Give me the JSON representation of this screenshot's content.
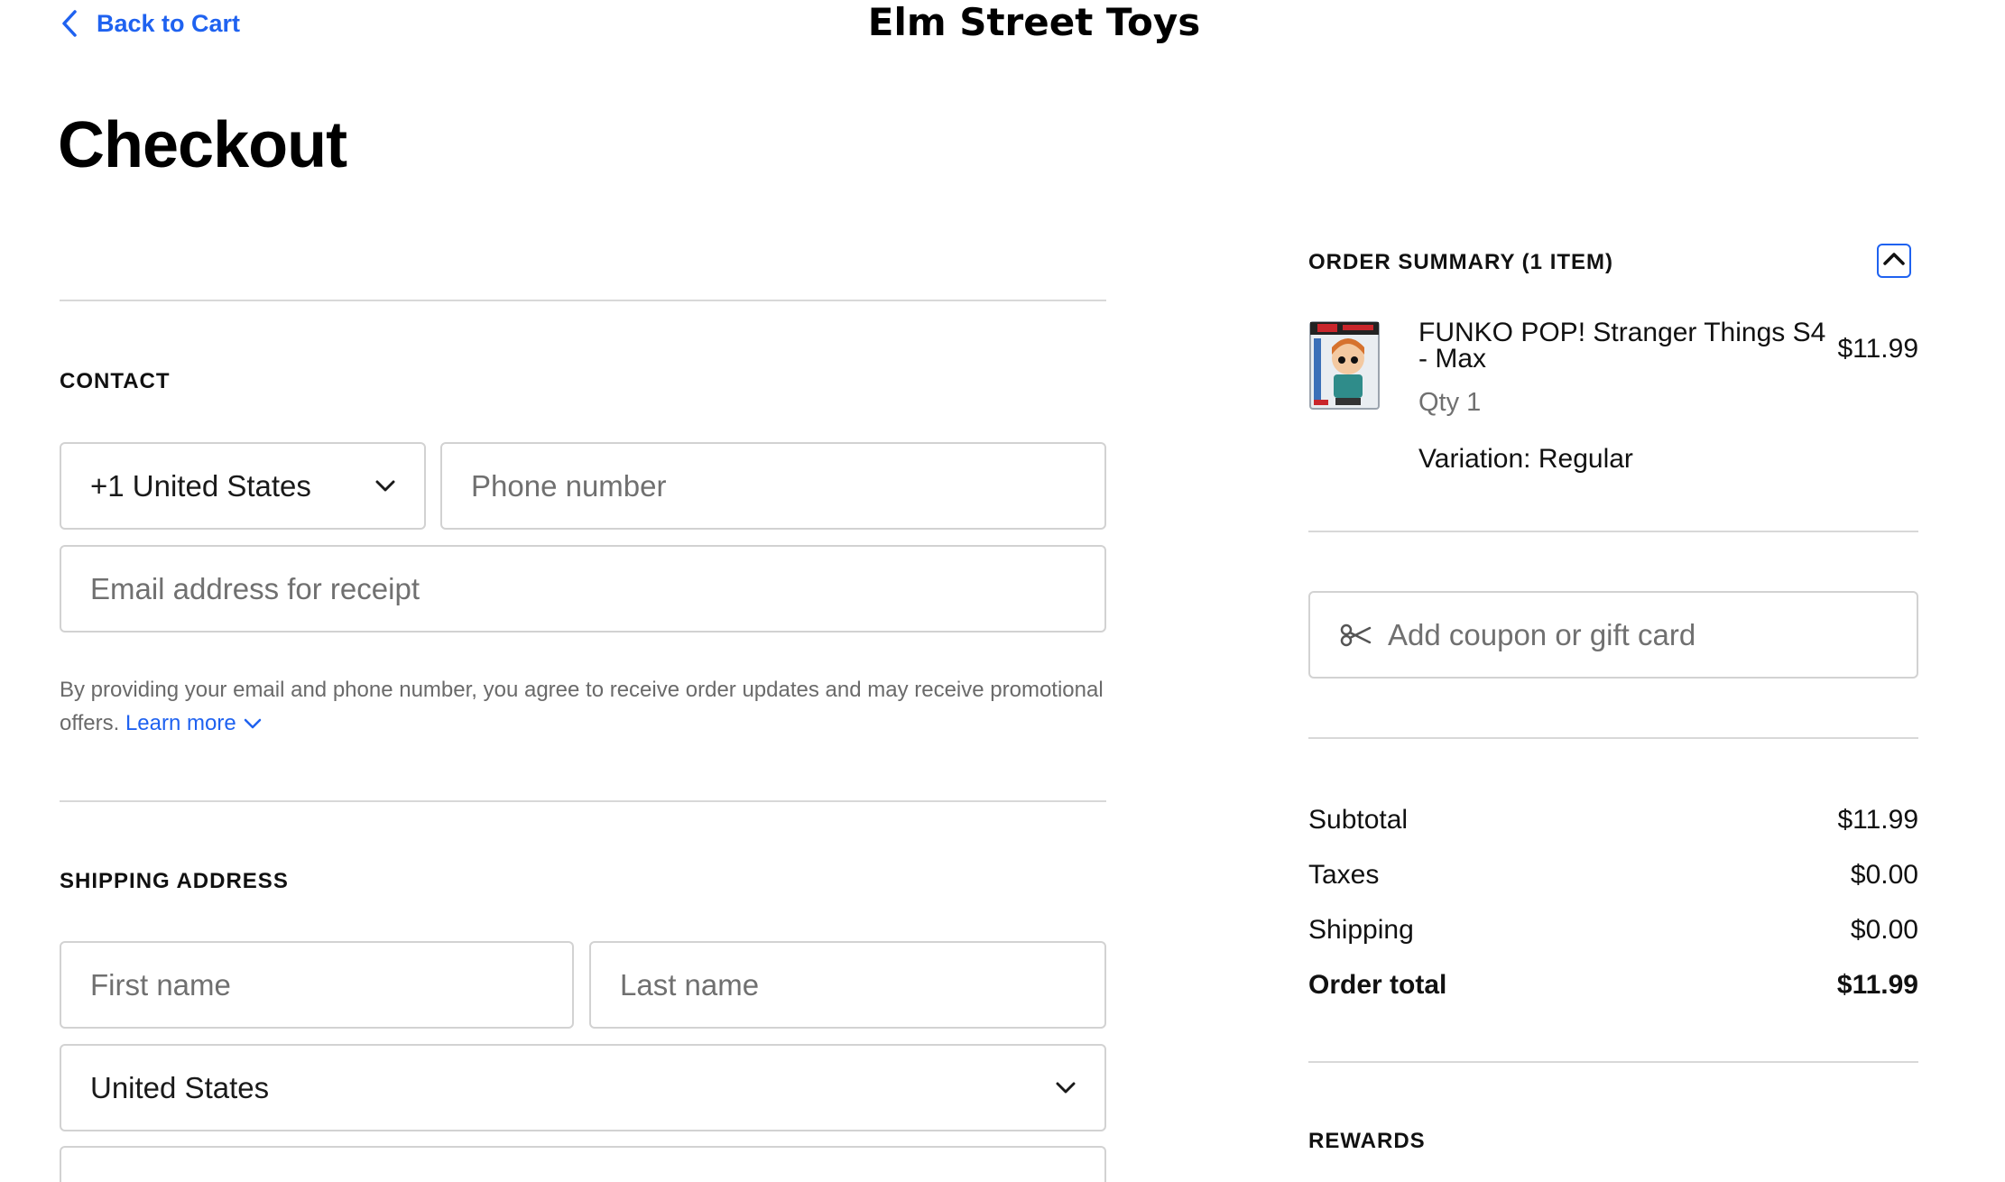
{
  "header": {
    "back_label": "Back to Cart",
    "store_name": "Elm Street Toys"
  },
  "page_title": "Checkout",
  "contact": {
    "section_label": "CONTACT",
    "country_code": "+1 United States",
    "phone_placeholder": "Phone number",
    "email_placeholder": "Email address for receipt",
    "disclaimer": "By providing your email and phone number, you agree to receive order updates and may receive promotional offers.",
    "learn_more": "Learn more"
  },
  "shipping": {
    "section_label": "SHIPPING ADDRESS",
    "first_name_placeholder": "First name",
    "last_name_placeholder": "Last name",
    "country": "United States"
  },
  "order_summary": {
    "title": "ORDER SUMMARY (1 ITEM)",
    "item": {
      "name": "FUNKO POP! Stranger Things S4 - Max",
      "price": "$11.99",
      "qty": "Qty 1",
      "variation": "Variation: Regular"
    },
    "coupon_placeholder": "Add coupon or gift card",
    "totals": [
      {
        "label": "Subtotal",
        "value": "$11.99"
      },
      {
        "label": "Taxes",
        "value": "$0.00"
      },
      {
        "label": "Shipping",
        "value": "$0.00"
      },
      {
        "label": "Order total",
        "value": "$11.99"
      }
    ],
    "rewards_label": "REWARDS"
  },
  "colors": {
    "accent": "#1f62f0",
    "border": "#d2d2d2",
    "divider": "#d8d8d8",
    "muted_text": "#6a6a6a"
  },
  "icons": {
    "back": "chevron-left-icon",
    "select": "chevron-down-icon",
    "learn_more": "chevron-down-icon",
    "summary_toggle": "chevron-up-icon",
    "coupon": "tag-icon"
  }
}
